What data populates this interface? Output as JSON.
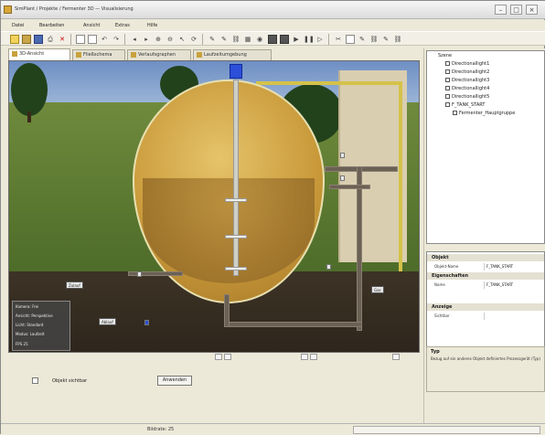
{
  "window": {
    "title": "SimPlant / Projekte / Fermenter 3D — Visualisierung"
  },
  "menu": [
    "Datei",
    "Bearbeiten",
    "Ansicht",
    "Extras",
    "Hilfe"
  ],
  "tabs": [
    {
      "label": "3D-Ansicht"
    },
    {
      "label": "Fließschema"
    },
    {
      "label": "Verlaufsgraphen"
    },
    {
      "label": "Laufzeitumgebung"
    }
  ],
  "viewport": {
    "labels": [
      "Zulauf",
      "Ablauf",
      "Gas"
    ],
    "info_lines": [
      "Kamera: Frei",
      "Ansicht: Perspektive",
      "Licht: Standard",
      "Modus: Laufzeit",
      "FPS 25"
    ]
  },
  "bottom": {
    "checkbox_label": "Objekt sichtbar",
    "apply_label": "Anwenden"
  },
  "scene_tree": {
    "root": "Szene",
    "items": [
      "Directionallight1",
      "Directionallight2",
      "Directionallight3",
      "Directionallight4",
      "Directionallight5",
      "F_TANK_START",
      "Fermenter_Hauptgruppe"
    ]
  },
  "properties": {
    "sections": [
      "Objekt",
      "Eigenschaften",
      "Anzeige"
    ],
    "rows": [
      {
        "key": "Objekt-Name",
        "value": "F_TANK_START"
      },
      {
        "key": "Name",
        "value": "F_TANK_START"
      },
      {
        "key": "Sichtbar",
        "value": ""
      }
    ]
  },
  "description": {
    "title": "Typ",
    "text": "Bezug auf ein anderes Objekt definiertes Prozessgerät (Typ)"
  },
  "status": {
    "text": "Bildrate: 25"
  },
  "colors": {
    "tank": "#c99a3a",
    "motor": "#2b4fd8",
    "pipe_yellow": "#d4c24a",
    "soil": "#3d3326"
  }
}
